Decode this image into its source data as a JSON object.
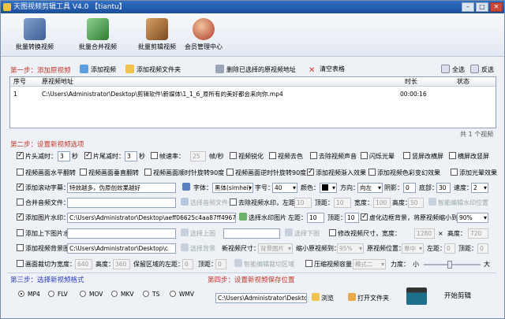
{
  "title": "天图视频剪辑工具 V4.0 【tiantu】",
  "toolbar": [
    {
      "label": "批量转换视频",
      "color": "#4a6fa5"
    },
    {
      "label": "批量合并视频",
      "color": "#2e8b57"
    },
    {
      "label": "批量剪辑视频",
      "color": "#8b5a2b"
    },
    {
      "label": "会员管理中心",
      "color": "#b03a2e"
    }
  ],
  "step1": {
    "title": "第一步：添加原视频",
    "add_video": "添加视频",
    "add_folder": "添加视频文件夹",
    "delete_selected": "删除已选择的原视频地址",
    "clear_table": "清空表格",
    "select_all": "全选",
    "invert": "反选"
  },
  "table": {
    "headers": [
      "序号",
      "原视频地址",
      "时长",
      "状态"
    ],
    "rows": [
      {
        "index": "1",
        "path": "C:\\Users\\Administrator\\Desktop\\剪辑软件\\新媒体\\1_1_6_原所有的美好都会来向你.mp4",
        "duration": "00:00:16",
        "status": ""
      }
    ],
    "count": "共 1 个视频"
  },
  "step2": {
    "title": "第二步：设置新视频选项",
    "r1": {
      "head_cut": "片头减时：",
      "head_val": "3",
      "tail_cut": "片尾减时：",
      "tail_val": "3",
      "sec": "秒",
      "frame_rate": "帧速率：",
      "frame_val": "25",
      "frame_unit": "帧/秒",
      "sharpen": "视频锐化",
      "decolor": "视频去色",
      "remove_audio": "去除视频声音",
      "flash": "闪烁光晕",
      "to_landscape": "竖屏改横屏",
      "to_portrait": "横屏改竖屏"
    },
    "r2": {
      "hflip": "视频画面水平翻转",
      "vflip": "视频画面垂直翻转",
      "cw90": "视频画面顺时针旋转90度",
      "ccw90": "视频画面逆时针旋转90度",
      "fade_in": "添加视频渐入效果",
      "random_color": "添加视频色彩变幻效果",
      "light": "添加光晕效果"
    },
    "r3": {
      "scroll_sub": "添加滚动字幕：",
      "sub_text": "特效越多，伪原创效果越好",
      "font_label": "字体：",
      "font_val": "黑体(simhei)",
      "size_label": "字号：",
      "size_val": "40",
      "color_label": "颜色：",
      "dir_label": "方向：",
      "dir_val": "向左",
      "shadow_label": "阴影：",
      "shadow_val": "0",
      "bottom_label": "底部：",
      "bottom_val": "30",
      "speed_label": "速度：",
      "speed_val": "2"
    },
    "r4": {
      "merge_audio": "合并音频文件：",
      "choose_audio": "选择音频文件",
      "remove_wm": "去除视频水印，左距：",
      "left_val": "10",
      "top_label": "顶距：",
      "top_val": "10",
      "width_label": "宽度：",
      "width_val": "100",
      "height_label": "高度：",
      "height_val": "50",
      "smart_wm": "智能编辑水印位置"
    },
    "r5": {
      "pic_wm": "添加图片水印：",
      "pic_path": "C:\\Users\\Administrator\\Desktop\\aeff06625c4aa87ff49676e43",
      "choose_wm": "选择水印图片",
      "left_label": "左距：",
      "left_val": "10",
      "top_label": "顶距：",
      "top_val": "10",
      "blur": "虚化边框背景，将原视频缩小到：",
      "blur_val": "90%"
    },
    "r6": {
      "top_bottom": "添加上下图片水印：",
      "choose_top": "选择上图",
      "choose_bottom": "选择下图",
      "resize": "修改视频尺寸，宽度：",
      "w_val": "1280",
      "x": "×",
      "h_label": "高度：",
      "h_val": "720"
    },
    "r7": {
      "bg_pic": "添加视频背景图片：",
      "bg_path": "C:\\Users\\Administrator\\Desktop\\c",
      "choose_bg": "选择背景",
      "new_size": "新视频尺寸：",
      "new_size_val": "背景图片",
      "shrink": "缩小原视频到：",
      "shrink_val": "95%",
      "pos": "原视频位置：",
      "pos_val": "靠中",
      "left": "左距：",
      "left_val": "0",
      "top": "顶距：",
      "top_val": "0"
    },
    "r8": {
      "crop": "画面裁切为宽度：",
      "crop_w": "640",
      "crop_h_label": "高度：",
      "crop_h": "360",
      "keep_left": "保留区域的左距：",
      "keep_left_val": "0",
      "keep_top": "顶距：",
      "keep_top_val": "0",
      "smart_crop": "智能编辑裁切区域",
      "compress": "压缩视频容量",
      "mode": "模式二",
      "strength": "力度：",
      "small": "小",
      "large": "大"
    }
  },
  "step3": {
    "title": "第三步：选择新视频格式",
    "formats": [
      "MP4",
      "FLV",
      "MOV",
      "MKV",
      "TS",
      "WMV"
    ],
    "selected": "MP4"
  },
  "step4": {
    "title": "第四步：设置新视频保存位置",
    "save_path": "C:\\Users\\Administrator\\Desktop",
    "browse": "浏览",
    "open_folder": "打开文件夹",
    "start": "开始剪辑"
  }
}
